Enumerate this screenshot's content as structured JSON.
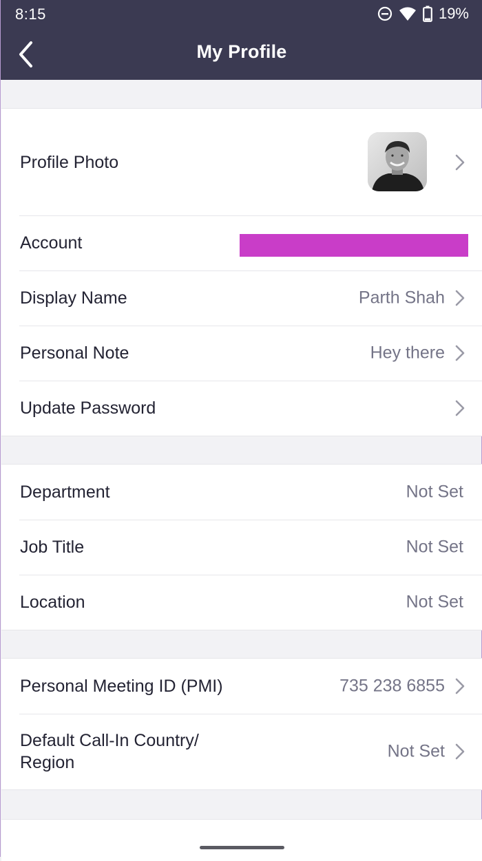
{
  "status_bar": {
    "time": "8:15",
    "battery": "19%",
    "icons": [
      "do-not-disturb-icon",
      "wifi-icon",
      "battery-icon"
    ]
  },
  "header": {
    "title": "My Profile",
    "back_icon": "chevron-left-icon"
  },
  "colors": {
    "header_bg": "#3b3a52",
    "redaction": "#c93dc8",
    "value_text": "#747487",
    "label_text": "#232333",
    "page_bg": "#f2f2f5"
  },
  "profile_section": {
    "photo_label": "Profile Photo",
    "account_label": "Account",
    "display_name_label": "Display Name",
    "display_name_value": "Parth Shah",
    "personal_note_label": "Personal Note",
    "personal_note_value": "Hey there",
    "update_password_label": "Update Password"
  },
  "work_section": {
    "department_label": "Department",
    "department_value": "Not Set",
    "job_title_label": "Job Title",
    "job_title_value": "Not Set",
    "location_label": "Location",
    "location_value": "Not Set"
  },
  "meeting_section": {
    "pmi_label": "Personal Meeting ID (PMI)",
    "pmi_value": "735 238 6855",
    "call_in_label_line1": "Default Call-In Country/",
    "call_in_label_line2": "Region",
    "call_in_value": "Not Set"
  }
}
